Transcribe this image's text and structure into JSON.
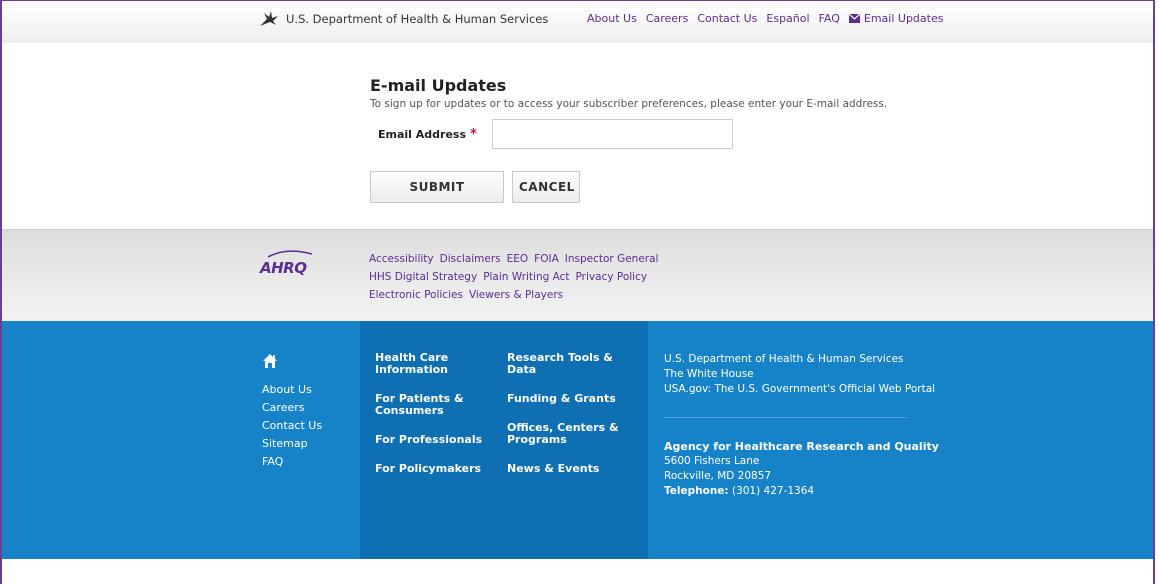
{
  "header": {
    "hhs_name": "U.S. Department of Health & Human Services",
    "nav": [
      "About Us",
      "Careers",
      "Contact Us",
      "Español",
      "FAQ"
    ],
    "email_updates": "Email Updates"
  },
  "form": {
    "title": "E-mail Updates",
    "description": "To sign up for updates or to access your subscriber preferences, please enter your E-mail address.",
    "email_label": "Email Address",
    "required_marker": "*",
    "email_value": "",
    "submit_label": "SUBMIT",
    "cancel_label": "CANCEL"
  },
  "footer_links": {
    "logo_text": "AHRQ",
    "row1": [
      "Accessibility",
      "Disclaimers",
      "EEO",
      "FOIA",
      "Inspector General"
    ],
    "row2": [
      "HHS Digital Strategy",
      "Plain Writing Act",
      "Privacy Policy"
    ],
    "row3": [
      "Electronic Policies",
      "Viewers & Players"
    ]
  },
  "footer_main": {
    "home_icon": "home-icon",
    "home_links": [
      "About Us",
      "Careers",
      "Contact Us",
      "Sitemap",
      "FAQ"
    ],
    "col2": [
      "Health Care Information",
      "For Patients & Consumers",
      "For Professionals",
      "For Policymakers"
    ],
    "col3": [
      "Research Tools & Data",
      "Funding & Grants",
      "Offices, Centers & Programs",
      "News & Events"
    ],
    "gov_links": [
      "U.S. Department of Health & Human Services",
      "The White House",
      "USA.gov: The U.S. Government's Official Web Portal"
    ],
    "agency_name": "Agency for Healthcare Research and Quality",
    "address1": "5600 Fishers Lane",
    "address2": "Rockville, MD 20857",
    "phone_label": "Telephone:",
    "phone": "(301) 427-1364"
  },
  "colors": {
    "brand_purple": "#5c2d91",
    "footer_blue": "#1683c9",
    "footer_blue_dark": "#0f6fb3",
    "required_red": "#c0143c"
  }
}
